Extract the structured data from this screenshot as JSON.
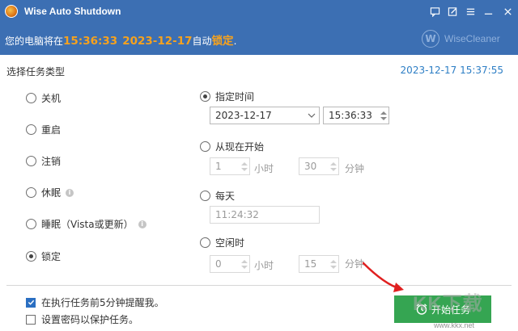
{
  "window": {
    "title": "Wise Auto Shutdown",
    "icons": [
      "feedback-icon",
      "edit-icon",
      "menu-icon",
      "minimize-icon",
      "close-icon"
    ]
  },
  "header": {
    "prefix": "您的电脑将在",
    "time": "15:36:33",
    "date": "2023-12-17",
    "middle": "自动",
    "action": "锁定",
    "suffix": ".",
    "brand": "WiseCleaner",
    "brand_mark": "W"
  },
  "section_title": "选择任务类型",
  "current_datetime": "2023-12-17 15:37:55",
  "tasks": [
    {
      "label": "关机",
      "selected": false,
      "info": false
    },
    {
      "label": "重启",
      "selected": false,
      "info": false
    },
    {
      "label": "注销",
      "selected": false,
      "info": false
    },
    {
      "label": "休眠",
      "selected": false,
      "info": true
    },
    {
      "label": "睡眠（Vista或更新）",
      "selected": false,
      "info": true
    },
    {
      "label": "锁定",
      "selected": true,
      "info": false
    }
  ],
  "schedule": {
    "specified_time": {
      "label": "指定时间",
      "selected": true,
      "date": "2023-12-17",
      "time": "15:36:33"
    },
    "from_now": {
      "label": "从现在开始",
      "selected": false,
      "hours": "1",
      "hours_unit": "小时",
      "minutes": "30",
      "minutes_unit": "分钟"
    },
    "daily": {
      "label": "每天",
      "selected": false,
      "time": "11:24:32"
    },
    "idle": {
      "label": "空闲时",
      "selected": false,
      "hours": "0",
      "hours_unit": "小时",
      "minutes": "15",
      "minutes_unit": "分钟"
    }
  },
  "options": {
    "remind": {
      "label": "在执行任务前5分钟提醒我。",
      "checked": true
    },
    "password": {
      "label": "设置密码以保护任务。",
      "checked": false
    }
  },
  "start_button": {
    "label": "开始任务",
    "icon": "alarm-clock-icon"
  },
  "watermark": {
    "text": "KK下载",
    "url": "www.kkx.net"
  },
  "colors": {
    "title_bar": "#3c6fb3",
    "highlight": "#f6a21e",
    "accent_blue": "#2d7ec5",
    "start_green": "#35a552",
    "arrow_red": "#e02020"
  }
}
